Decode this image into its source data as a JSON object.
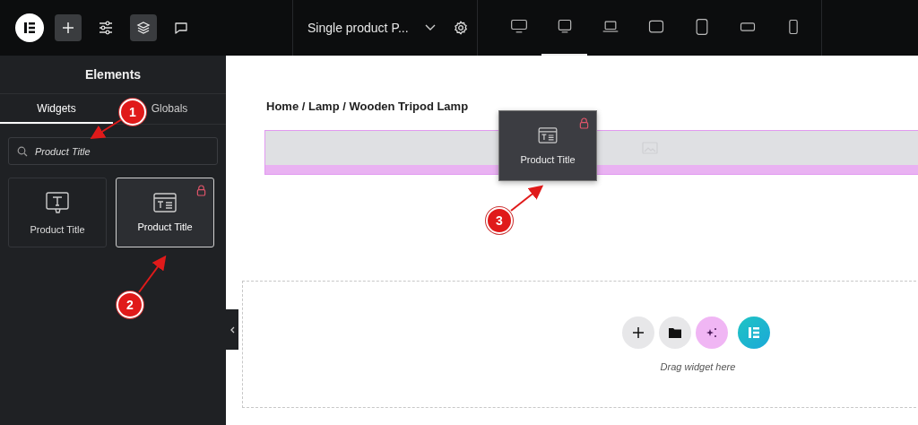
{
  "topbar": {
    "document_title": "Single product P...",
    "devices": [
      {
        "kind": "desktop-wide",
        "selected": false
      },
      {
        "kind": "desktop",
        "selected": true
      },
      {
        "kind": "laptop",
        "selected": false
      },
      {
        "kind": "tablet-landscape",
        "selected": false
      },
      {
        "kind": "tablet",
        "selected": false
      },
      {
        "kind": "phone-landscape",
        "selected": false
      },
      {
        "kind": "phone",
        "selected": false
      }
    ]
  },
  "sidebar": {
    "title": "Elements",
    "tabs": [
      {
        "label": "Widgets",
        "selected": true
      },
      {
        "label": "Globals",
        "selected": false
      }
    ],
    "search": {
      "value": "Product Title"
    },
    "widgets": [
      {
        "label": "Product Title",
        "kind": "text-cursor",
        "locked": false,
        "selected": false
      },
      {
        "label": "Product Title",
        "kind": "title-card",
        "locked": true,
        "selected": true
      }
    ]
  },
  "canvas": {
    "breadcrumb": "Home / Lamp / Wooden Tripod Lamp",
    "dragged_widget": {
      "label": "Product Title",
      "locked": true
    },
    "drop_hint": "Drag widget here"
  },
  "annotations": [
    {
      "number": "1"
    },
    {
      "number": "2"
    },
    {
      "number": "3"
    }
  ]
}
